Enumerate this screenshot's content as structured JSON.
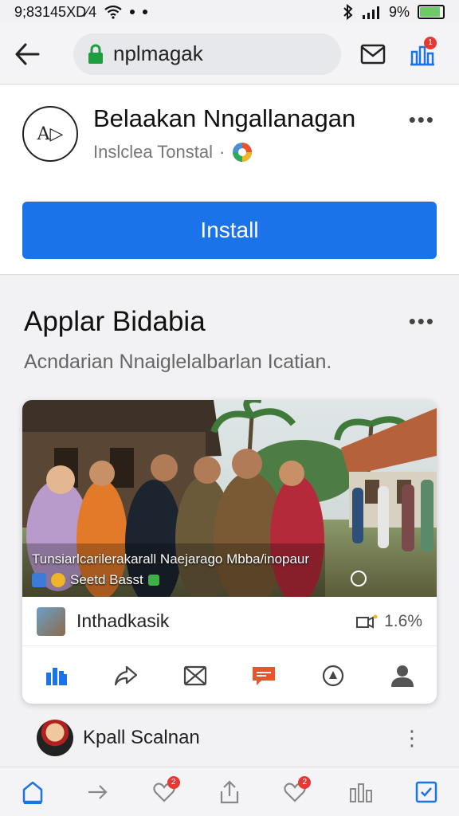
{
  "status_bar": {
    "time_text": "9;83145XD⁄4",
    "battery_text": "9%",
    "battery_level": 0.9
  },
  "browser": {
    "url": "nplmagak",
    "notification_count": "1"
  },
  "app": {
    "logo_text": "A▷",
    "title": "Belaakan Nngallanagan",
    "subtitle": "Inslclea Tonstal",
    "install_label": "Install"
  },
  "feed": {
    "title": "Applar Bidabia",
    "description": "Acndarian Nnaiglelalbarlan Icatian.",
    "post": {
      "caption": "Tunsiarlcarilerakarall Naejarago Mbba/inopaur",
      "tag_text": "Seetd Basst",
      "author": "Inthadkasik",
      "stat": "1.6%"
    }
  },
  "next_post": {
    "author": "Kpall Scalnan"
  },
  "bottom_nav": {
    "badge_1": "2",
    "badge_2": "2"
  },
  "colors": {
    "accent": "#1a73e8",
    "badge": "#e53935",
    "comment_icon": "#e8542c"
  }
}
